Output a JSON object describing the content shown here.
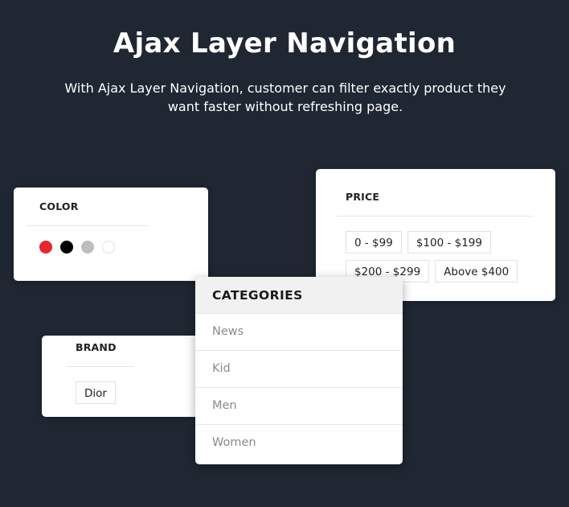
{
  "hero": {
    "title": "Ajax Layer Navigation",
    "subtitle": "With Ajax Layer Navigation, customer can filter exactly product they want faster without refreshing page."
  },
  "color_filter": {
    "title": "COLOR",
    "swatches": [
      {
        "name": "red",
        "hex": "#e8262b"
      },
      {
        "name": "black",
        "hex": "#000000"
      },
      {
        "name": "gray",
        "hex": "#bdbdbd"
      },
      {
        "name": "white",
        "hex": "#ffffff"
      }
    ]
  },
  "price_filter": {
    "title": "PRICE",
    "options": [
      "0 - $99",
      "$100 - $199",
      "$200 - $299",
      "Above $400"
    ]
  },
  "brand_filter": {
    "title": "BRAND",
    "options": [
      "Dior"
    ]
  },
  "categories": {
    "title": "CATEGORIES",
    "items": [
      "News",
      "Kid",
      "Men",
      "Women"
    ]
  }
}
